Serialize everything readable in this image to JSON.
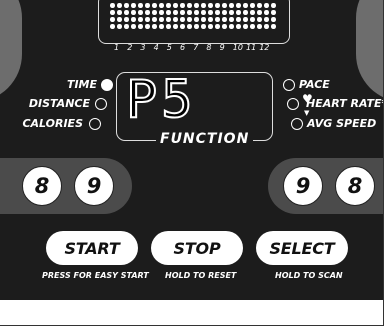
{
  "dot_matrix": {
    "columns": [
      "1",
      "2",
      "3",
      "4",
      "5",
      "6",
      "7",
      "8",
      "9",
      "10",
      "11",
      "12"
    ]
  },
  "left_indicators": [
    {
      "label": "TIME",
      "active": true
    },
    {
      "label": "DISTANCE",
      "active": false
    },
    {
      "label": "CALORIES",
      "active": false
    }
  ],
  "right_indicators": [
    {
      "label": "PACE",
      "active": false
    },
    {
      "label": "HEART RATE*",
      "active": false
    },
    {
      "label": "AVG SPEED",
      "active": false
    }
  ],
  "display": {
    "readout": "P5",
    "label": "FUNCTION"
  },
  "left_rollers": [
    "8",
    "9"
  ],
  "right_rollers": [
    "9",
    "8"
  ],
  "buttons": {
    "start": {
      "label": "START",
      "hint": "PRESS FOR EASY START"
    },
    "stop": {
      "label": "STOP",
      "hint": "HOLD TO RESET"
    },
    "select": {
      "label": "SELECT",
      "hint": "HOLD TO SCAN"
    }
  },
  "colors": {
    "console": "#1c1c1c",
    "band": "#4b4b4b",
    "led_text": "#ffffff"
  }
}
